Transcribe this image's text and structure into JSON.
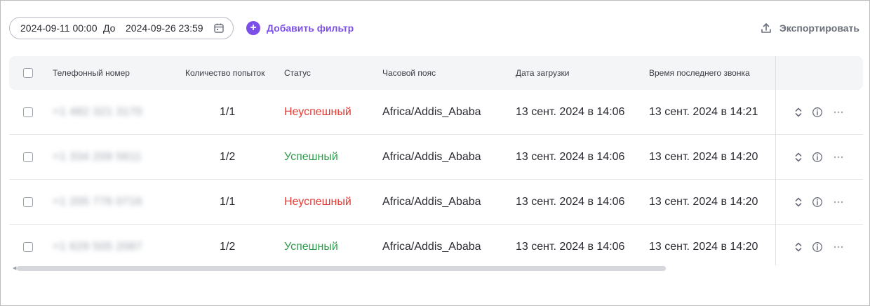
{
  "toolbar": {
    "date_from": "2024-09-11 00:00",
    "separator": "До",
    "date_to": "2024-09-26 23:59",
    "calendar_icon": "calendar-icon",
    "add_filter_label": "Добавить фильтр",
    "add_filter_icon": "plus-circle-icon",
    "export_label": "Экспортировать",
    "export_icon": "upload-icon"
  },
  "table": {
    "columns": [
      "Телефонный номер",
      "Количество попыток",
      "Статус",
      "Часовой пояс",
      "Дата загрузки",
      "Время последнего звонка"
    ],
    "rows": [
      {
        "phone": "+1 482 321 3170",
        "attempts": "1/1",
        "status": "Неуспешный",
        "status_type": "fail",
        "timezone": "Africa/Addis_Ababa",
        "uploaded": "13 сент. 2024 в 14:06",
        "last_call": "13 сент. 2024 в 14:21"
      },
      {
        "phone": "+1 334 209 5611",
        "attempts": "1/2",
        "status": "Успешный",
        "status_type": "ok",
        "timezone": "Africa/Addis_Ababa",
        "uploaded": "13 сент. 2024 в 14:06",
        "last_call": "13 сент. 2024 в 14:20"
      },
      {
        "phone": "+1 205 776 0716",
        "attempts": "1/1",
        "status": "Неуспешный",
        "status_type": "fail",
        "timezone": "Africa/Addis_Ababa",
        "uploaded": "13 сент. 2024 в 14:06",
        "last_call": "13 сент. 2024 в 14:20"
      },
      {
        "phone": "+1 629 505 2087",
        "attempts": "1/2",
        "status": "Успешный",
        "status_type": "ok",
        "timezone": "Africa/Addis_Ababa",
        "uploaded": "13 сент. 2024 в 14:06",
        "last_call": "13 сент. 2024 в 14:20"
      }
    ],
    "row_actions": [
      "sort-arrows-icon",
      "info-icon",
      "more-icon"
    ]
  },
  "colors": {
    "accent": "#7b4fe8",
    "status_fail": "#e53935",
    "status_ok": "#2e9e4f",
    "header_bg": "#f4f5f7"
  }
}
